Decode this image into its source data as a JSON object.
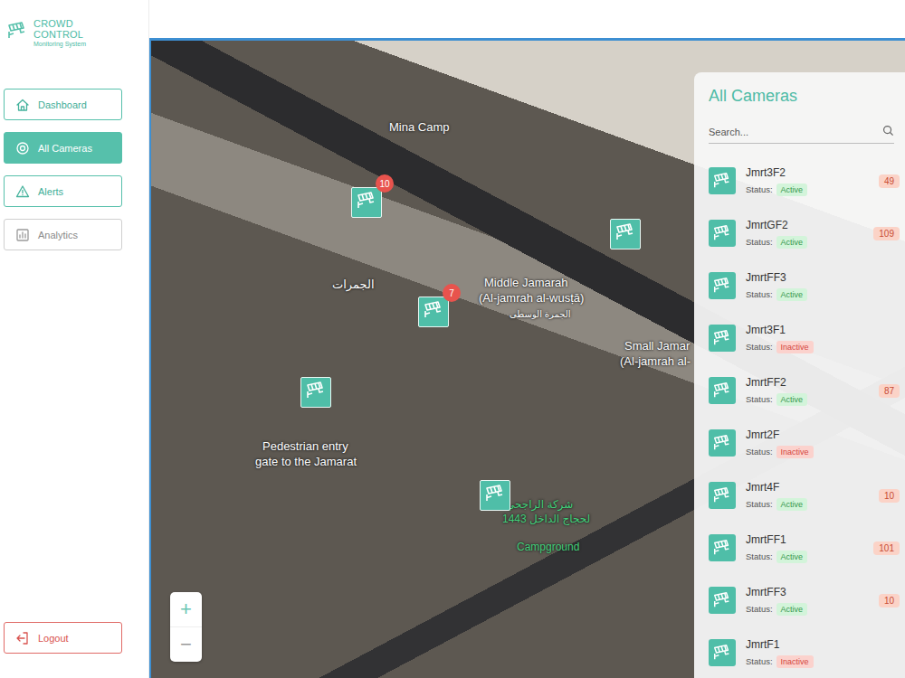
{
  "logo": {
    "title": "CROWD CONTROL",
    "subtitle": "Monitoring System"
  },
  "sidebar": {
    "items": [
      {
        "label": "Dashboard",
        "selected": false,
        "disabled": false
      },
      {
        "label": "All Cameras",
        "selected": true,
        "disabled": false
      },
      {
        "label": "Alerts",
        "selected": false,
        "disabled": false
      },
      {
        "label": "Analytics",
        "selected": false,
        "disabled": true
      }
    ],
    "logout": "Logout"
  },
  "map": {
    "labels": [
      {
        "text": "Mina Camp",
        "kind": "place"
      },
      {
        "text": "الجمرات",
        "kind": "place"
      },
      {
        "text": "Middle Jamarah",
        "kind": "place"
      },
      {
        "text": "(Al-jamrah al-wusṭā)",
        "kind": "place"
      },
      {
        "text": "الجمرة الوسطى",
        "kind": "small"
      },
      {
        "text": "Small Jamar",
        "kind": "place"
      },
      {
        "text": "(Al-jamrah al-",
        "kind": "place"
      },
      {
        "text": "Pedestrian entry",
        "kind": "place"
      },
      {
        "text": "gate to the Jamarat",
        "kind": "place"
      },
      {
        "text": "شركة الراجحي",
        "kind": "camp"
      },
      {
        "text": "لحجاج الداخل 1443",
        "kind": "camp"
      },
      {
        "text": "Campground",
        "kind": "camp"
      }
    ],
    "pins": [
      {
        "badge": "10"
      },
      {
        "badge": ""
      },
      {
        "badge": "7"
      },
      {
        "badge": ""
      },
      {
        "badge": ""
      }
    ],
    "zoom_in": "+",
    "zoom_out": "−"
  },
  "camera_panel": {
    "title": "All Cameras",
    "search": {
      "placeholder": "Search..."
    },
    "status_label": "Status:",
    "cameras": [
      {
        "name": "Jmrt3F2",
        "status": "Active",
        "active": true,
        "count": "49"
      },
      {
        "name": "JmrtGF2",
        "status": "Active",
        "active": true,
        "count": "109"
      },
      {
        "name": "JmrtFF3",
        "status": "Active",
        "active": true,
        "count": ""
      },
      {
        "name": "Jmrt3F1",
        "status": "Inactive",
        "active": false,
        "count": ""
      },
      {
        "name": "JmrtFF2",
        "status": "Active",
        "active": true,
        "count": "87"
      },
      {
        "name": "Jmrt2F",
        "status": "Inactive",
        "active": false,
        "count": ""
      },
      {
        "name": "Jmrt4F",
        "status": "Active",
        "active": true,
        "count": "10"
      },
      {
        "name": "JmrtFF1",
        "status": "Active",
        "active": true,
        "count": "101"
      },
      {
        "name": "JmrtFF3",
        "status": "Active",
        "active": true,
        "count": "10"
      },
      {
        "name": "JmrtF1",
        "status": "Inactive",
        "active": false,
        "count": ""
      }
    ]
  }
}
